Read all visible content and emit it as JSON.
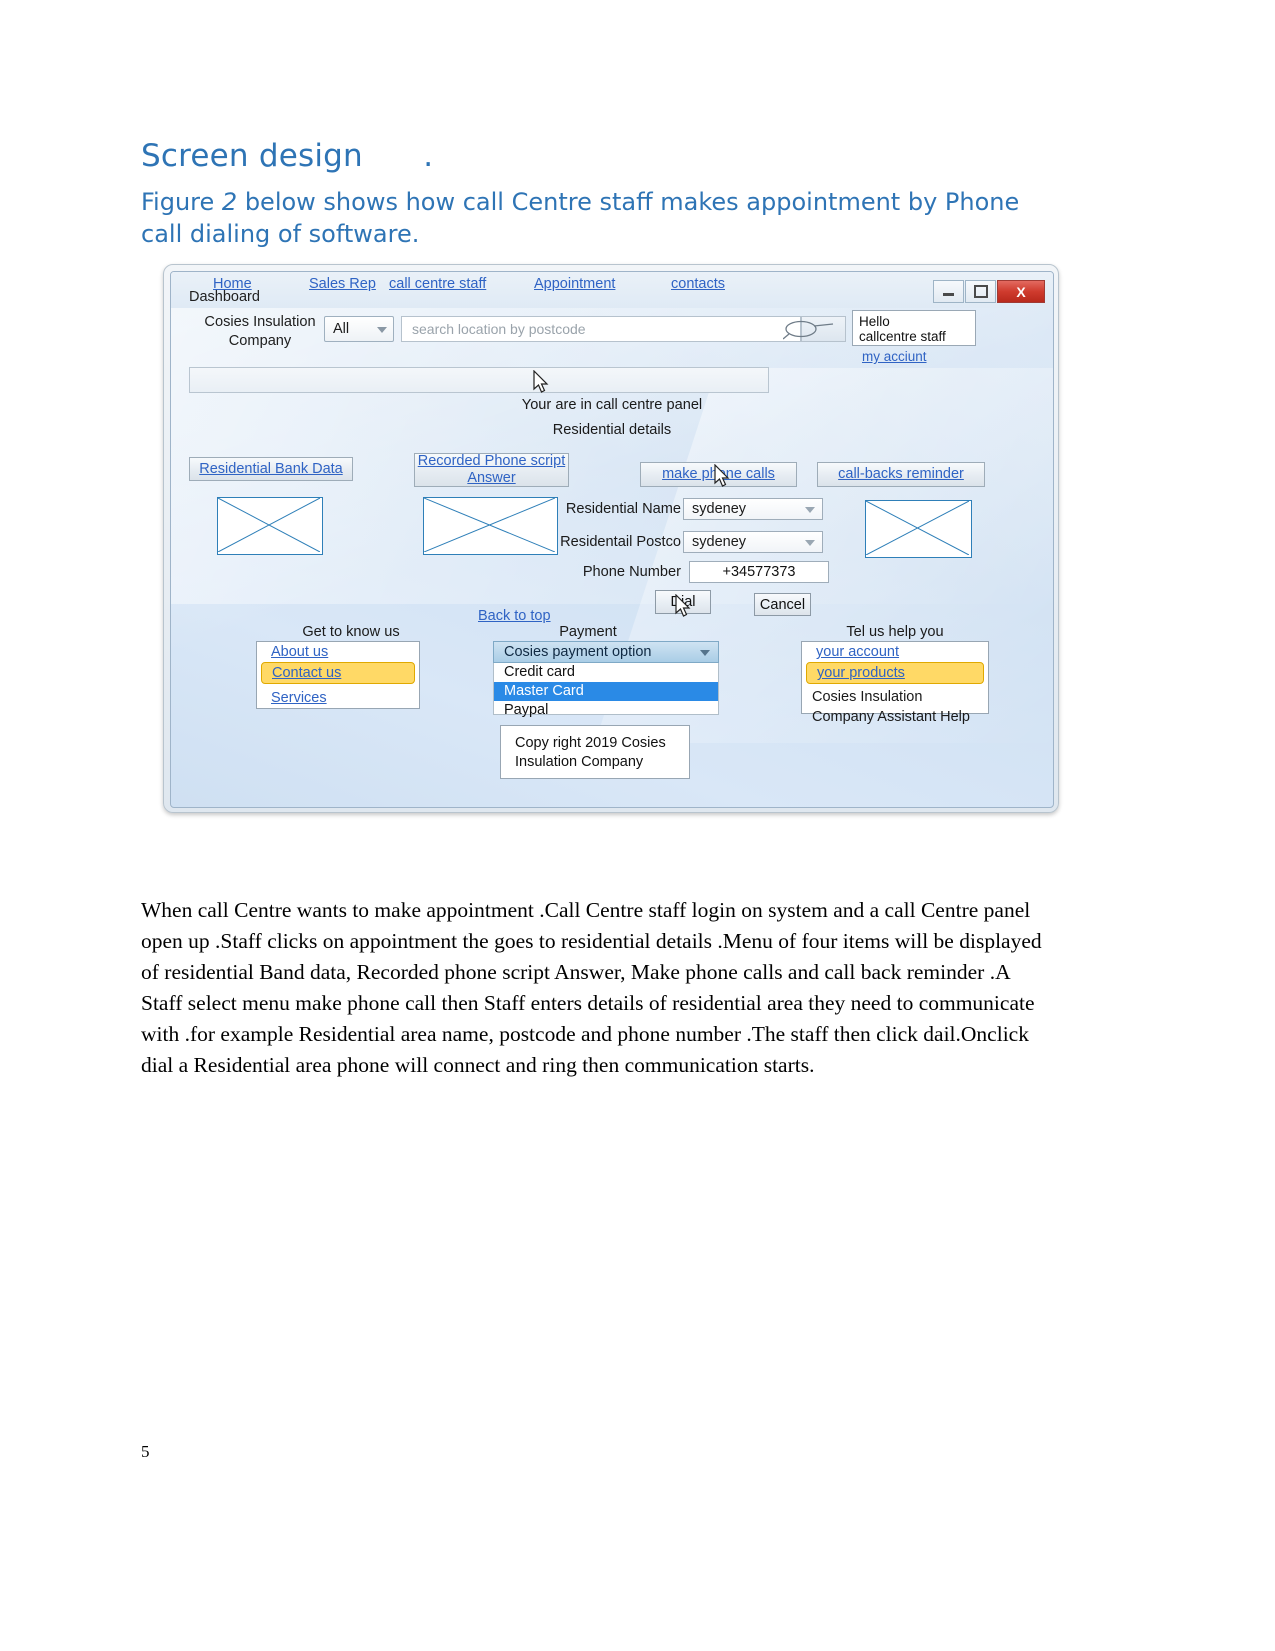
{
  "document": {
    "heading": "Screen design      .",
    "subheading_pre": "Figure ",
    "subheading_em": "2",
    "subheading_post": " below shows how call Centre staff makes appointment by Phone call dialing of software.",
    "body": "When call Centre wants to make appointment .Call Centre staff login on system and  a call Centre panel open up .Staff clicks on appointment the goes to residential details .Menu of four items will be displayed of residential Band data, Recorded phone script Answer, Make phone calls and call back reminder .A Staff select menu make phone call then  Staff enters details of residential area they need to communicate with .for example Residential area name, postcode and phone number .The staff then click dail.Onclick dial a Residential area phone will connect and ring then communication starts.",
    "page_number": "5"
  },
  "mockup": {
    "window_title": "Dashboard",
    "window_buttons": {
      "minimize": "minimize-icon",
      "maximize": "maximize-icon",
      "close": "X"
    },
    "brand": "Cosies Insulation Company",
    "category_select": {
      "value": "All"
    },
    "search": {
      "placeholder": "search location by postcode",
      "value": ""
    },
    "account_box": {
      "line1": "Hello",
      "line2": "callcentre staff",
      "link": "my acciunt"
    },
    "nav": [
      {
        "label": "Home"
      },
      {
        "label": "Sales Rep"
      },
      {
        "label": "call centre staff"
      },
      {
        "label": "Appointment"
      },
      {
        "label": "contacts"
      }
    ],
    "panel_note": "Your are in call centre panel",
    "panel_sub": "Residential details",
    "action_buttons": [
      {
        "label": "Residential Bank Data"
      },
      {
        "label": "Recorded Phone script Answer"
      },
      {
        "label": "make phone calls"
      },
      {
        "label": "call-backs reminder"
      }
    ],
    "form": {
      "name_label": "Residential Name",
      "name_value": "sydeney",
      "postcode_label": "Residentail Postco",
      "postcode_value": "sydeney",
      "phone_label": "Phone Number",
      "phone_value": "+34577373",
      "dial_button": "Dial",
      "cancel_button": "Cancel"
    },
    "back_to_top": "Back to top",
    "get_to_know_us": {
      "title": "Get to know us",
      "items": [
        {
          "label": "About us",
          "highlighted": false
        },
        {
          "label": "Contact us",
          "highlighted": true
        },
        {
          "label": "Services",
          "highlighted": false
        }
      ]
    },
    "payment": {
      "title": "Payment",
      "header": "Cosies payment option",
      "options": [
        {
          "label": "Credit card",
          "selected": false
        },
        {
          "label": "Master Card",
          "selected": true
        },
        {
          "label": "Paypal",
          "selected": false
        }
      ]
    },
    "help": {
      "title": "Tel us help you",
      "items": [
        {
          "label": "your account",
          "highlighted": false,
          "link": true
        },
        {
          "label": "your products",
          "highlighted": true,
          "link": true
        },
        {
          "label": "Cosies Insulation",
          "highlighted": false,
          "link": false
        },
        {
          "label": "Company Assistant Help",
          "highlighted": false,
          "link": false
        }
      ]
    },
    "copyright_line1": "Copy right 2019 Cosies",
    "copyright_line2": "Insulation Company"
  },
  "colors": {
    "heading_blue": "#2E74B5",
    "link_blue": "#2f63c4",
    "highlight_yellow": "#ffd966",
    "select_blue": "#2a8ae6",
    "close_red": "#cf3b2e"
  }
}
